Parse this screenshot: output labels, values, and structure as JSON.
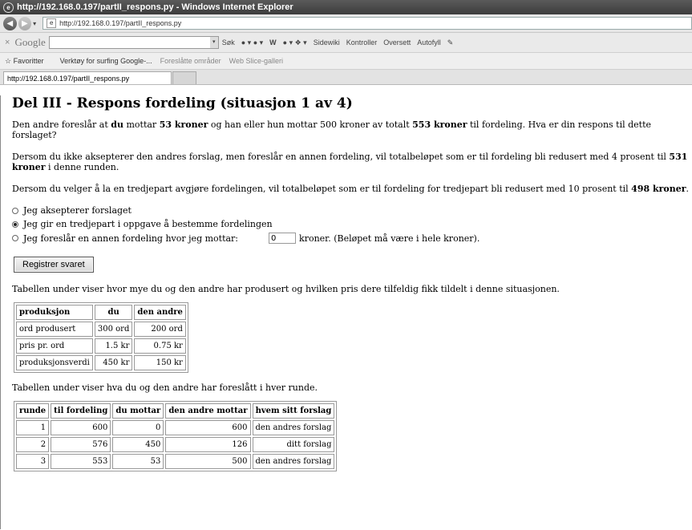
{
  "window": {
    "title": "http://192.168.0.197/partII_respons.py - Windows Internet Explorer"
  },
  "address": {
    "url": "http://192.168.0.197/partII_respons.py"
  },
  "googlebar": {
    "logo": "Google",
    "items": [
      "Søk",
      "W",
      "Sidewiki",
      "Kontroller",
      "Oversett",
      "Autofyll"
    ]
  },
  "favorites": {
    "favorites_label": "Favoritter",
    "item1": "Verktøy for surfing Google-...",
    "item2": "Foreslåtte områder",
    "item3": "Web Slice-galleri"
  },
  "tab": {
    "label": "http://192.168.0.197/partII_respons.py"
  },
  "page": {
    "heading": "Del III - Respons fordeling (situasjon 1 av 4)",
    "para1": {
      "t1": "Den andre foreslår at ",
      "b1": "du",
      "t2": " mottar ",
      "b2": "53 kroner",
      "t3": " og han eller hun mottar 500 kroner av totalt ",
      "b3": "553 kroner",
      "t4": " til fordeling. Hva er din respons til dette forslaget?"
    },
    "para2": {
      "t1": "Dersom du ikke aksepterer den andres forslag, men foreslår en annen fordeling, vil totalbeløpet som er til fordeling bli redusert med 4 prosent til ",
      "b1": "531 kroner",
      "t2": " i denne runden."
    },
    "para3": {
      "t1": "Dersom du velger å la en tredjepart avgjøre fordelingen, vil totalbeløpet som er til fordeling for tredjepart bli redusert med 10 prosent til ",
      "b1": "498 kroner",
      "t2": "."
    },
    "options": {
      "accept": "Jeg aksepterer forslaget",
      "thirdparty": "Jeg gir en tredjepart i oppgave å bestemme fordelingen",
      "propose": "Jeg foreslår en annen fordeling hvor jeg mottar:",
      "selected": "thirdparty"
    },
    "amount_input": {
      "value": "0"
    },
    "amount_suffix": "kroner. (Beløpet må være i hele kroner).",
    "submit_label": "Registrer svaret",
    "table1_intro": "Tabellen under viser hvor mye du og den andre har produsert og hvilken pris dere tilfeldig fikk tildelt i denne situasjonen.",
    "table1": {
      "headers": [
        "produksjon",
        "du",
        "den andre"
      ],
      "rows": [
        [
          "ord produsert",
          "300 ord",
          "200 ord"
        ],
        [
          "pris pr. ord",
          "1.5 kr",
          "0.75 kr"
        ],
        [
          "produksjonsverdi",
          "450 kr",
          "150 kr"
        ]
      ]
    },
    "table2_intro": "Tabellen under viser hva du og den andre har foreslått i hver runde.",
    "table2": {
      "headers": [
        "runde",
        "til fordeling",
        "du mottar",
        "den andre mottar",
        "hvem sitt forslag"
      ],
      "rows": [
        [
          "1",
          "600",
          "0",
          "600",
          "den andres forslag"
        ],
        [
          "2",
          "576",
          "450",
          "126",
          "ditt forslag"
        ],
        [
          "3",
          "553",
          "53",
          "500",
          "den andres forslag"
        ]
      ]
    }
  }
}
